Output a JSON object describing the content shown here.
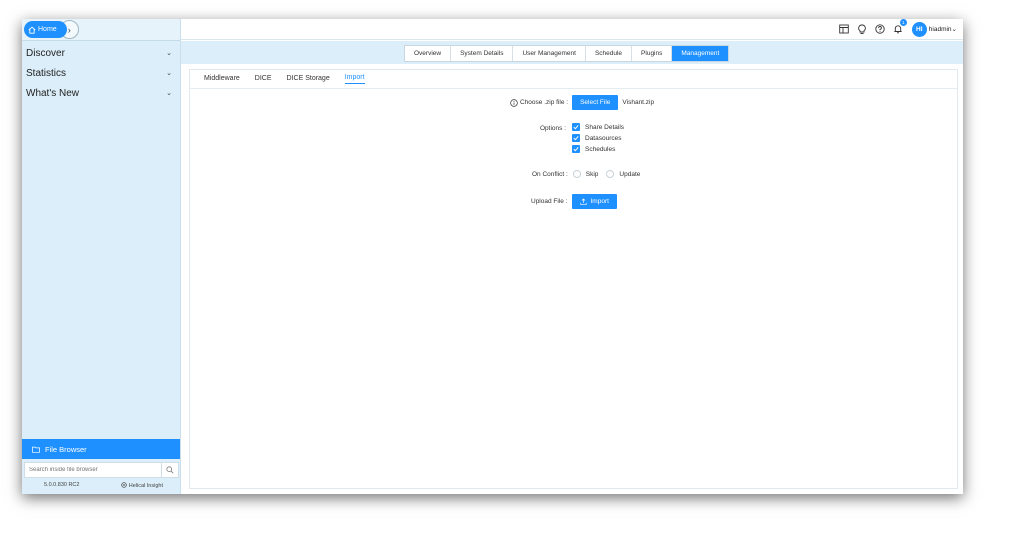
{
  "sidebar": {
    "home_label": "Home",
    "items": [
      {
        "label": "Discover"
      },
      {
        "label": "Statistics"
      },
      {
        "label": "What's New"
      }
    ],
    "file_browser_label": "File Browser",
    "search_placeholder": "Search inside file browser",
    "version": "5.0.0.830 RC2",
    "brand": "Helical Insight"
  },
  "topbar": {
    "notification_count": "1",
    "avatar_initials": "HI",
    "username": "hiadmin"
  },
  "tabs": [
    {
      "label": "Overview"
    },
    {
      "label": "System Details"
    },
    {
      "label": "User Management"
    },
    {
      "label": "Schedule"
    },
    {
      "label": "Plugins"
    },
    {
      "label": "Management",
      "active": true
    }
  ],
  "subtabs": [
    {
      "label": "Middleware"
    },
    {
      "label": "DICE"
    },
    {
      "label": "DICE Storage"
    },
    {
      "label": "Import",
      "active": true
    }
  ],
  "form": {
    "choose_label": "Choose .zip file :",
    "select_button": "Select File",
    "selected_file": "Vishant.zip",
    "options_label": "Options :",
    "options": [
      {
        "label": "Share Details",
        "checked": true
      },
      {
        "label": "Datasources",
        "checked": true
      },
      {
        "label": "Schedules",
        "checked": true
      }
    ],
    "conflict_label": "On Conflict :",
    "conflict_options": [
      {
        "label": "Skip"
      },
      {
        "label": "Update"
      }
    ],
    "upload_label": "Upload File :",
    "import_button": "Import"
  },
  "colors": {
    "accent": "#1e90ff",
    "sidebar_bg": "#dbeef9"
  }
}
